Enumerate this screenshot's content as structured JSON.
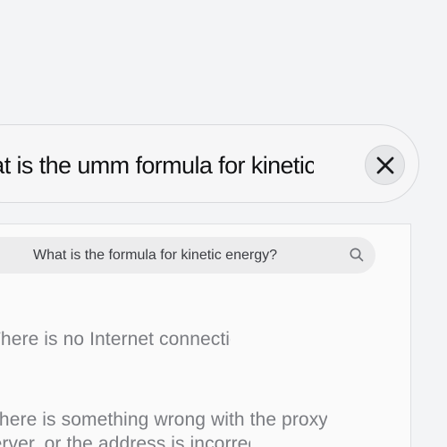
{
  "query": {
    "text": "What is the umm formula for kinetic energy"
  },
  "close_button": {
    "icon": "close-icon"
  },
  "browser": {
    "search": {
      "value": "What is the formula for kinetic energy?",
      "icon": "search-icon"
    },
    "error_lines": [
      "There is no Internet connection",
      "There is something wrong with the proxy",
      "server, or the address is incorrect."
    ]
  }
}
